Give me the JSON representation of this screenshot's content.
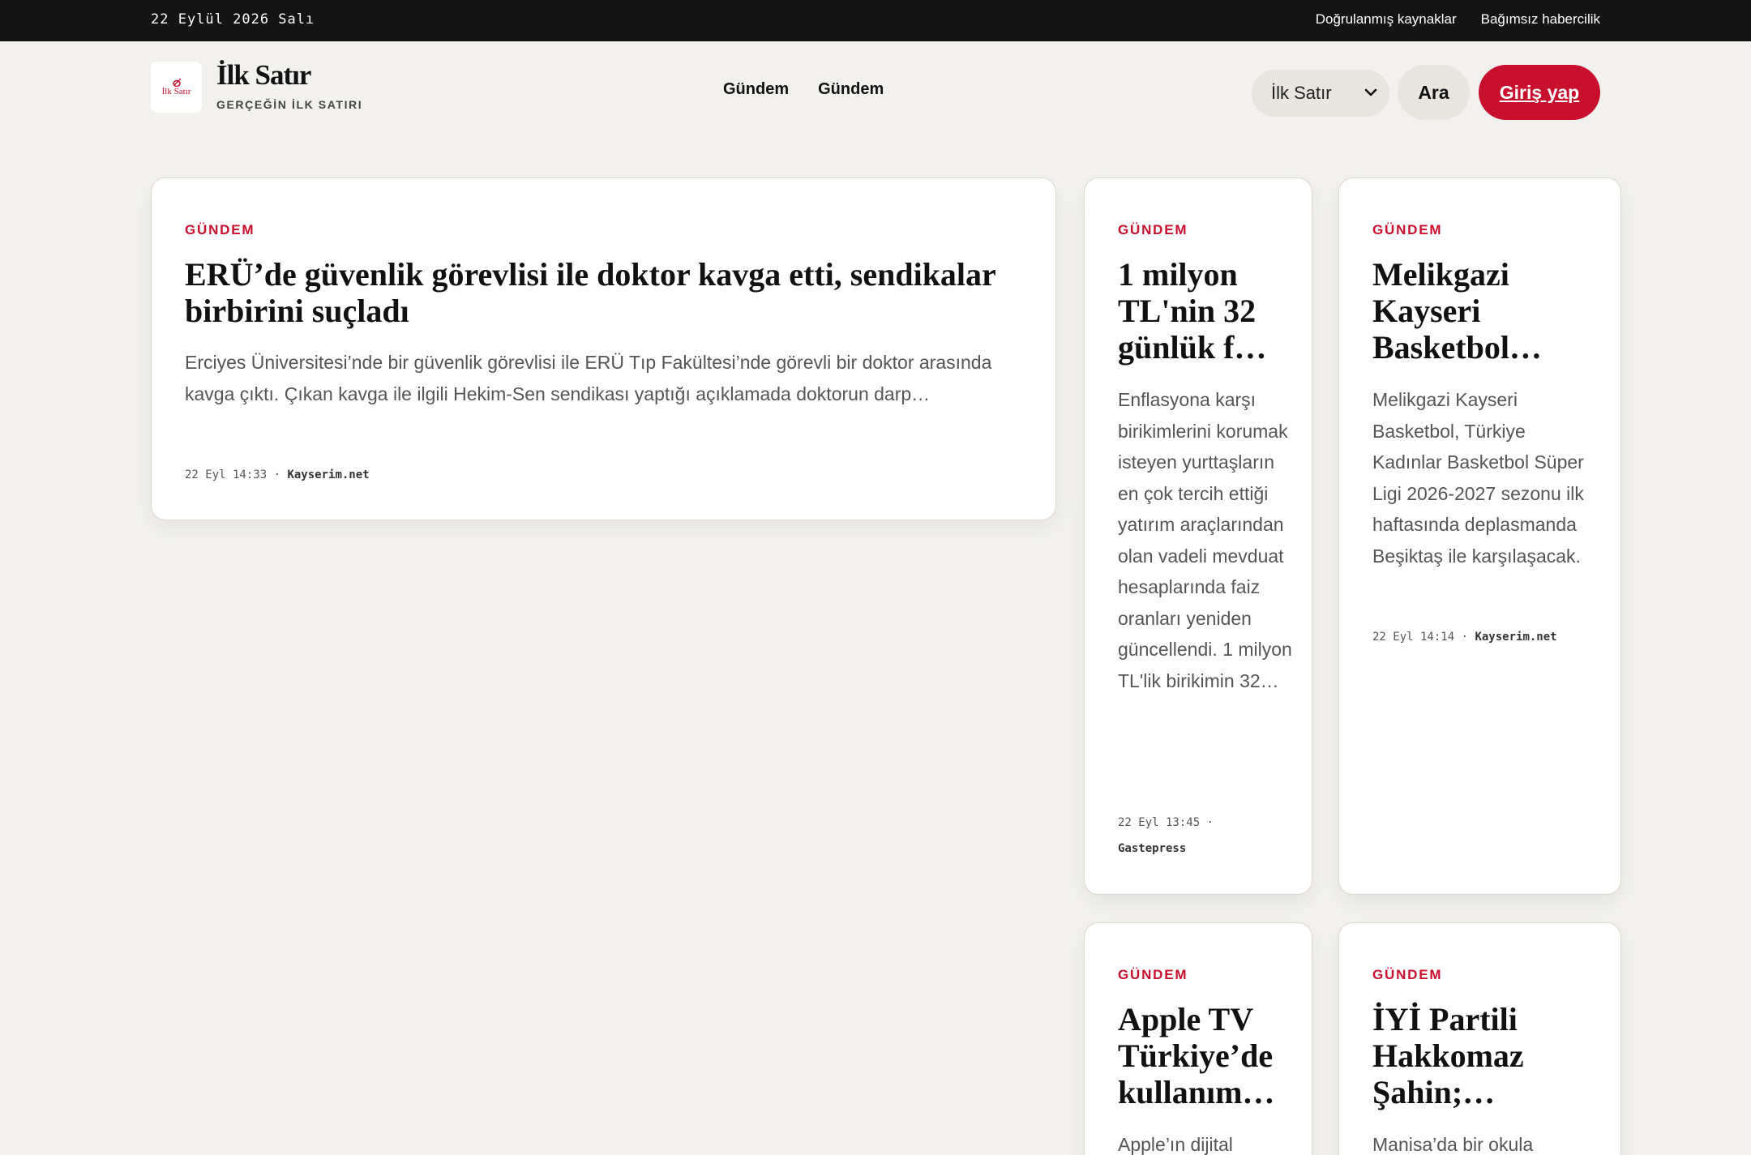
{
  "topbar": {
    "date": "22 Eylül 2026 Salı",
    "links": [
      "Doğrulanmış kaynaklar",
      "Bağımsız habercilik"
    ]
  },
  "brand": {
    "logo_text": "İlk Satır",
    "name": "İlk Satır",
    "tagline": "GERÇEĞİN İLK SATIRI",
    "accent": "#c8102e"
  },
  "nav": [
    "Gündem",
    "Gündem"
  ],
  "header_actions": {
    "select_value": "İlk Satır",
    "search_label": "Ara",
    "login_label": "Giriş yap"
  },
  "articles": [
    {
      "category": "GÜNDEM",
      "title": "ERÜ’de güvenlik görevlisi ile doktor kavga etti, sendikalar birbirini suçladı",
      "excerpt": "Erciyes Üniversitesi’nde bir güvenlik görevlisi ile ERÜ Tıp Fakültesi’nde görevli bir doktor arasında kavga çıktı. Çıkan kavga ile ilgili Hekim-Sen sendikası yaptığı açıklamada doktorun darp…",
      "time": "22 Eyl 14:33",
      "source": "Kayserim.net"
    },
    {
      "category": "GÜNDEM",
      "title": "1 milyon TL'nin 32 günlük f…",
      "excerpt": "Enflasyona karşı birikimlerini korumak isteyen yurttaşların en çok tercih ettiği yatırım araçlarından olan vadeli mevduat hesaplarında faiz oranları yeniden güncellendi. 1 milyon TL'lik birikimin 32…",
      "time": "22 Eyl 13:45",
      "source": "Gastepress"
    },
    {
      "category": "GÜNDEM",
      "title": "Melikgazi Kayseri Basketbol…",
      "excerpt": "Melikgazi Kayseri Basketbol, Türkiye Kadınlar Basketbol Süper Ligi 2026-2027 sezonu ilk haftasında deplasmanda Beşiktaş ile karşılaşacak.",
      "time": "22 Eyl 14:14",
      "source": "Kayserim.net"
    },
    {
      "category": "GÜNDEM",
      "title": "Apple TV Türkiye’de kullanım…",
      "excerpt": "Apple’ın dijital"
    },
    {
      "category": "GÜNDEM",
      "title": "İYİ Partili Hakkomaz Şahin;…",
      "excerpt": "Manisa’da bir okula"
    }
  ]
}
